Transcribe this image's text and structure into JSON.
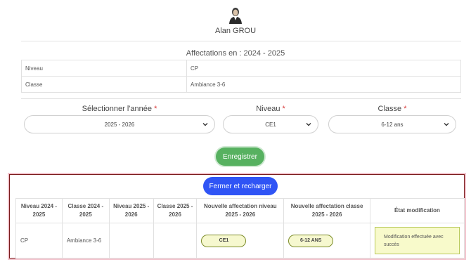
{
  "user": {
    "name": "Alan GROU",
    "avatar_icon": "user-avatar-icon"
  },
  "affectations": {
    "title": "Affectations en : 2024 - 2025",
    "rows": [
      {
        "label": "Niveau",
        "value": "CP"
      },
      {
        "label": "Classe",
        "value": "Ambiance 3-6"
      }
    ]
  },
  "form": {
    "required_mark": "*",
    "year": {
      "label": "Sélectionner l'année",
      "value": "2025 - 2026"
    },
    "level": {
      "label": "Niveau",
      "value": "CE1"
    },
    "class": {
      "label": "Classe",
      "value": "6-12 ans"
    },
    "save_label": "Enregistrer"
  },
  "result": {
    "close_label": "Fermer et recharger",
    "headers": [
      "Niveau 2024 - 2025",
      "Classe 2024 - 2025",
      "Niveau 2025 - 2026",
      "Classe 2025 - 2026",
      "Nouvelle affectation niveau 2025 - 2026",
      "Nouvelle affectation classe 2025 - 2026",
      "État modification"
    ],
    "row": {
      "niveau_prev": "CP",
      "classe_prev": "Ambiance 3-6",
      "niveau_next": "",
      "classe_next": "",
      "new_niveau": "CE1",
      "new_classe": "6-12 ANS",
      "status": "Modification effectuée avec succès"
    }
  },
  "colors": {
    "save": "#57b160",
    "close": "#2f54f5",
    "pill_bg": "#f6f8cf",
    "required": "#d83a3a"
  }
}
